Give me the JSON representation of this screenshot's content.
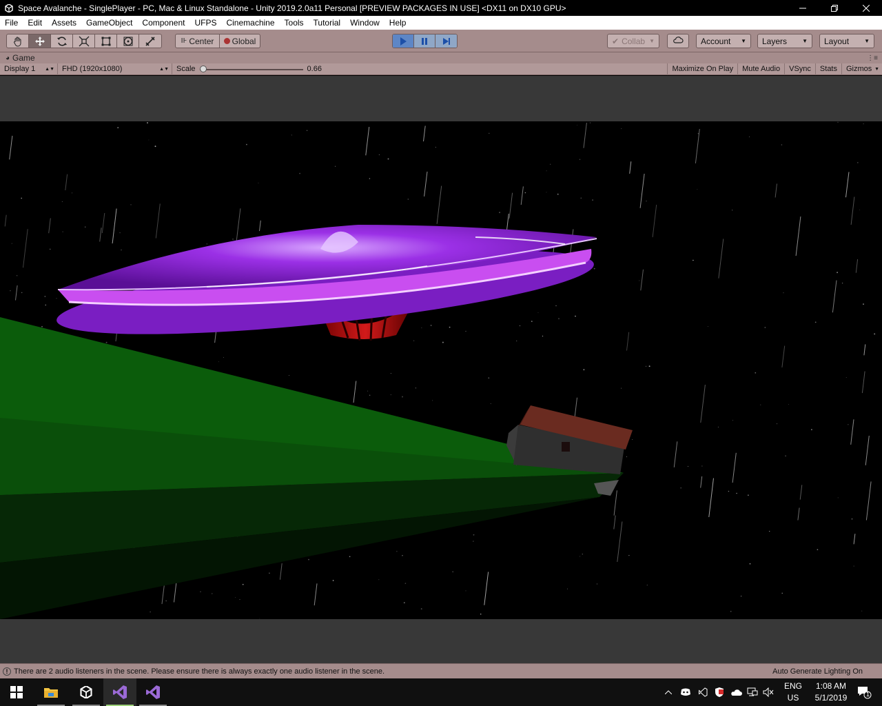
{
  "window": {
    "title": "Space Avalanche - SinglePlayer - PC, Mac & Linux Standalone - Unity 2019.2.0a11 Personal [PREVIEW PACKAGES IN USE] <DX11 on DX10 GPU>",
    "minimize_icon": "minimize-icon",
    "maximize_icon": "restore-icon",
    "close_icon": "close-icon"
  },
  "menu": [
    "File",
    "Edit",
    "Assets",
    "GameObject",
    "Component",
    "UFPS",
    "Cinemachine",
    "Tools",
    "Tutorial",
    "Window",
    "Help"
  ],
  "toolbar": {
    "tools": [
      "hand-tool-icon",
      "move-tool-icon",
      "rotate-tool-icon",
      "scale-tool-icon",
      "rect-tool-icon",
      "transform-tool-icon",
      "custom-tool-icon"
    ],
    "active_tool": "move-tool-icon",
    "pivot_label": "Center",
    "space_label": "Global",
    "play_icon": "play-icon",
    "pause_icon": "pause-icon",
    "step_icon": "step-icon",
    "collab_label": "Collab",
    "account_label": "Account",
    "layers_label": "Layers",
    "layout_label": "Layout"
  },
  "tab": {
    "label": "Game"
  },
  "game_toolbar": {
    "display": "Display 1",
    "resolution": "FHD (1920x1080)",
    "scale_label": "Scale",
    "scale_value": "0.66",
    "scale_fraction": 0.0,
    "maximize_on_play": "Maximize On Play",
    "mute_audio": "Mute Audio",
    "vsync": "VSync",
    "stats": "Stats",
    "gizmos": "Gizmos"
  },
  "status": {
    "message": "There are 2 audio listeners in the scene. Please ensure there is always exactly one audio listener in the scene.",
    "lighting": "Auto Generate Lighting On"
  },
  "taskbar": {
    "apps": [
      "windows-start-icon",
      "file-explorer-icon",
      "unity-icon",
      "visual-studio-icon",
      "visual-studio-icon"
    ],
    "language": "ENG",
    "region": "US",
    "time": "1:08 AM",
    "date": "5/1/2019",
    "notification_count": "1"
  },
  "colors": {
    "toolbar_bg": "#a58c8c",
    "ufo_purple": "#8a1cc9",
    "ufo_red": "#b01010",
    "ground_green": "#0b5a0b",
    "house_roof": "#6a2b20"
  }
}
